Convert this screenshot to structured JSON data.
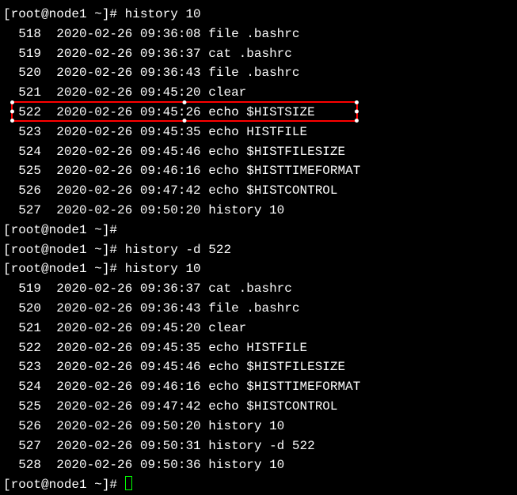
{
  "prompt1": {
    "text": "[root@node1 ~]# ",
    "command": "history 10"
  },
  "history1": [
    {
      "num": "  518",
      "ts": "2020-02-26 09:36:08",
      "cmd": "file .bashrc"
    },
    {
      "num": "  519",
      "ts": "2020-02-26 09:36:37",
      "cmd": "cat .bashrc"
    },
    {
      "num": "  520",
      "ts": "2020-02-26 09:36:43",
      "cmd": "file .bashrc"
    },
    {
      "num": "  521",
      "ts": "2020-02-26 09:45:20",
      "cmd": "clear"
    },
    {
      "num": "  522",
      "ts": "2020-02-26 09:45:26",
      "cmd": "echo $HISTSIZE",
      "highlighted": true
    },
    {
      "num": "  523",
      "ts": "2020-02-26 09:45:35",
      "cmd": "echo HISTFILE"
    },
    {
      "num": "  524",
      "ts": "2020-02-26 09:45:46",
      "cmd": "echo $HISTFILESIZE"
    },
    {
      "num": "  525",
      "ts": "2020-02-26 09:46:16",
      "cmd": "echo $HISTTIMEFORMAT"
    },
    {
      "num": "  526",
      "ts": "2020-02-26 09:47:42",
      "cmd": "echo $HISTCONTROL"
    },
    {
      "num": "  527",
      "ts": "2020-02-26 09:50:20",
      "cmd": "history 10"
    }
  ],
  "prompt2": {
    "text": "[root@node1 ~]# ",
    "command": ""
  },
  "prompt3": {
    "text": "[root@node1 ~]# ",
    "command": "history -d 522"
  },
  "prompt4": {
    "text": "[root@node1 ~]# ",
    "command": "history 10"
  },
  "history2": [
    {
      "num": "  519",
      "ts": "2020-02-26 09:36:37",
      "cmd": "cat .bashrc"
    },
    {
      "num": "  520",
      "ts": "2020-02-26 09:36:43",
      "cmd": "file .bashrc"
    },
    {
      "num": "  521",
      "ts": "2020-02-26 09:45:20",
      "cmd": "clear"
    },
    {
      "num": "  522",
      "ts": "2020-02-26 09:45:35",
      "cmd": "echo HISTFILE"
    },
    {
      "num": "  523",
      "ts": "2020-02-26 09:45:46",
      "cmd": "echo $HISTFILESIZE"
    },
    {
      "num": "  524",
      "ts": "2020-02-26 09:46:16",
      "cmd": "echo $HISTTIMEFORMAT"
    },
    {
      "num": "  525",
      "ts": "2020-02-26 09:47:42",
      "cmd": "echo $HISTCONTROL"
    },
    {
      "num": "  526",
      "ts": "2020-02-26 09:50:20",
      "cmd": "history 10"
    },
    {
      "num": "  527",
      "ts": "2020-02-26 09:50:31",
      "cmd": "history -d 522"
    },
    {
      "num": "  528",
      "ts": "2020-02-26 09:50:36",
      "cmd": "history 10"
    }
  ],
  "prompt5": {
    "text": "[root@node1 ~]# ",
    "command": ""
  }
}
